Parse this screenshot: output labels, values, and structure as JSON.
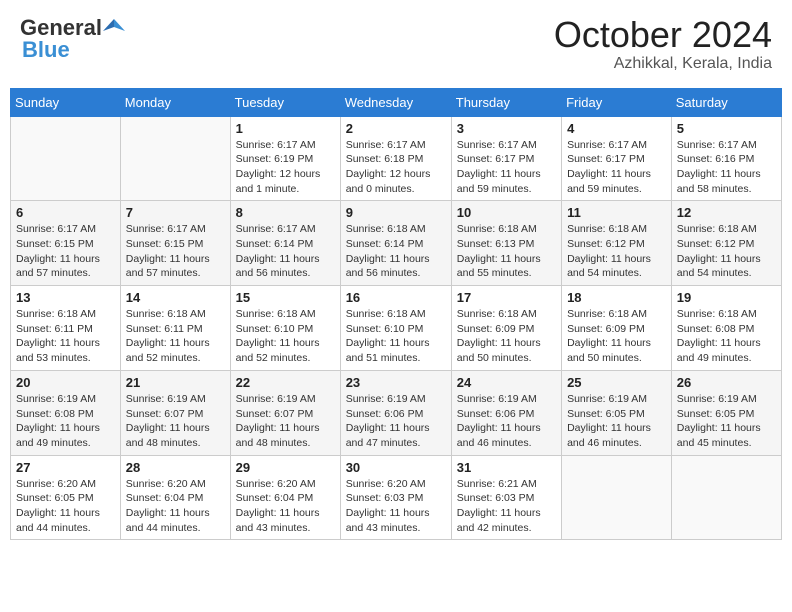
{
  "header": {
    "logo_general": "General",
    "logo_blue": "Blue",
    "month_title": "October 2024",
    "subtitle": "Azhikkal, Kerala, India"
  },
  "days_of_week": [
    "Sunday",
    "Monday",
    "Tuesday",
    "Wednesday",
    "Thursday",
    "Friday",
    "Saturday"
  ],
  "weeks": [
    [
      {
        "day": "",
        "sunrise": "",
        "sunset": "",
        "daylight": ""
      },
      {
        "day": "",
        "sunrise": "",
        "sunset": "",
        "daylight": ""
      },
      {
        "day": "1",
        "sunrise": "Sunrise: 6:17 AM",
        "sunset": "Sunset: 6:19 PM",
        "daylight": "Daylight: 12 hours and 1 minute."
      },
      {
        "day": "2",
        "sunrise": "Sunrise: 6:17 AM",
        "sunset": "Sunset: 6:18 PM",
        "daylight": "Daylight: 12 hours and 0 minutes."
      },
      {
        "day": "3",
        "sunrise": "Sunrise: 6:17 AM",
        "sunset": "Sunset: 6:17 PM",
        "daylight": "Daylight: 11 hours and 59 minutes."
      },
      {
        "day": "4",
        "sunrise": "Sunrise: 6:17 AM",
        "sunset": "Sunset: 6:17 PM",
        "daylight": "Daylight: 11 hours and 59 minutes."
      },
      {
        "day": "5",
        "sunrise": "Sunrise: 6:17 AM",
        "sunset": "Sunset: 6:16 PM",
        "daylight": "Daylight: 11 hours and 58 minutes."
      }
    ],
    [
      {
        "day": "6",
        "sunrise": "Sunrise: 6:17 AM",
        "sunset": "Sunset: 6:15 PM",
        "daylight": "Daylight: 11 hours and 57 minutes."
      },
      {
        "day": "7",
        "sunrise": "Sunrise: 6:17 AM",
        "sunset": "Sunset: 6:15 PM",
        "daylight": "Daylight: 11 hours and 57 minutes."
      },
      {
        "day": "8",
        "sunrise": "Sunrise: 6:17 AM",
        "sunset": "Sunset: 6:14 PM",
        "daylight": "Daylight: 11 hours and 56 minutes."
      },
      {
        "day": "9",
        "sunrise": "Sunrise: 6:18 AM",
        "sunset": "Sunset: 6:14 PM",
        "daylight": "Daylight: 11 hours and 56 minutes."
      },
      {
        "day": "10",
        "sunrise": "Sunrise: 6:18 AM",
        "sunset": "Sunset: 6:13 PM",
        "daylight": "Daylight: 11 hours and 55 minutes."
      },
      {
        "day": "11",
        "sunrise": "Sunrise: 6:18 AM",
        "sunset": "Sunset: 6:12 PM",
        "daylight": "Daylight: 11 hours and 54 minutes."
      },
      {
        "day": "12",
        "sunrise": "Sunrise: 6:18 AM",
        "sunset": "Sunset: 6:12 PM",
        "daylight": "Daylight: 11 hours and 54 minutes."
      }
    ],
    [
      {
        "day": "13",
        "sunrise": "Sunrise: 6:18 AM",
        "sunset": "Sunset: 6:11 PM",
        "daylight": "Daylight: 11 hours and 53 minutes."
      },
      {
        "day": "14",
        "sunrise": "Sunrise: 6:18 AM",
        "sunset": "Sunset: 6:11 PM",
        "daylight": "Daylight: 11 hours and 52 minutes."
      },
      {
        "day": "15",
        "sunrise": "Sunrise: 6:18 AM",
        "sunset": "Sunset: 6:10 PM",
        "daylight": "Daylight: 11 hours and 52 minutes."
      },
      {
        "day": "16",
        "sunrise": "Sunrise: 6:18 AM",
        "sunset": "Sunset: 6:10 PM",
        "daylight": "Daylight: 11 hours and 51 minutes."
      },
      {
        "day": "17",
        "sunrise": "Sunrise: 6:18 AM",
        "sunset": "Sunset: 6:09 PM",
        "daylight": "Daylight: 11 hours and 50 minutes."
      },
      {
        "day": "18",
        "sunrise": "Sunrise: 6:18 AM",
        "sunset": "Sunset: 6:09 PM",
        "daylight": "Daylight: 11 hours and 50 minutes."
      },
      {
        "day": "19",
        "sunrise": "Sunrise: 6:18 AM",
        "sunset": "Sunset: 6:08 PM",
        "daylight": "Daylight: 11 hours and 49 minutes."
      }
    ],
    [
      {
        "day": "20",
        "sunrise": "Sunrise: 6:19 AM",
        "sunset": "Sunset: 6:08 PM",
        "daylight": "Daylight: 11 hours and 49 minutes."
      },
      {
        "day": "21",
        "sunrise": "Sunrise: 6:19 AM",
        "sunset": "Sunset: 6:07 PM",
        "daylight": "Daylight: 11 hours and 48 minutes."
      },
      {
        "day": "22",
        "sunrise": "Sunrise: 6:19 AM",
        "sunset": "Sunset: 6:07 PM",
        "daylight": "Daylight: 11 hours and 48 minutes."
      },
      {
        "day": "23",
        "sunrise": "Sunrise: 6:19 AM",
        "sunset": "Sunset: 6:06 PM",
        "daylight": "Daylight: 11 hours and 47 minutes."
      },
      {
        "day": "24",
        "sunrise": "Sunrise: 6:19 AM",
        "sunset": "Sunset: 6:06 PM",
        "daylight": "Daylight: 11 hours and 46 minutes."
      },
      {
        "day": "25",
        "sunrise": "Sunrise: 6:19 AM",
        "sunset": "Sunset: 6:05 PM",
        "daylight": "Daylight: 11 hours and 46 minutes."
      },
      {
        "day": "26",
        "sunrise": "Sunrise: 6:19 AM",
        "sunset": "Sunset: 6:05 PM",
        "daylight": "Daylight: 11 hours and 45 minutes."
      }
    ],
    [
      {
        "day": "27",
        "sunrise": "Sunrise: 6:20 AM",
        "sunset": "Sunset: 6:05 PM",
        "daylight": "Daylight: 11 hours and 44 minutes."
      },
      {
        "day": "28",
        "sunrise": "Sunrise: 6:20 AM",
        "sunset": "Sunset: 6:04 PM",
        "daylight": "Daylight: 11 hours and 44 minutes."
      },
      {
        "day": "29",
        "sunrise": "Sunrise: 6:20 AM",
        "sunset": "Sunset: 6:04 PM",
        "daylight": "Daylight: 11 hours and 43 minutes."
      },
      {
        "day": "30",
        "sunrise": "Sunrise: 6:20 AM",
        "sunset": "Sunset: 6:03 PM",
        "daylight": "Daylight: 11 hours and 43 minutes."
      },
      {
        "day": "31",
        "sunrise": "Sunrise: 6:21 AM",
        "sunset": "Sunset: 6:03 PM",
        "daylight": "Daylight: 11 hours and 42 minutes."
      },
      {
        "day": "",
        "sunrise": "",
        "sunset": "",
        "daylight": ""
      },
      {
        "day": "",
        "sunrise": "",
        "sunset": "",
        "daylight": ""
      }
    ]
  ]
}
